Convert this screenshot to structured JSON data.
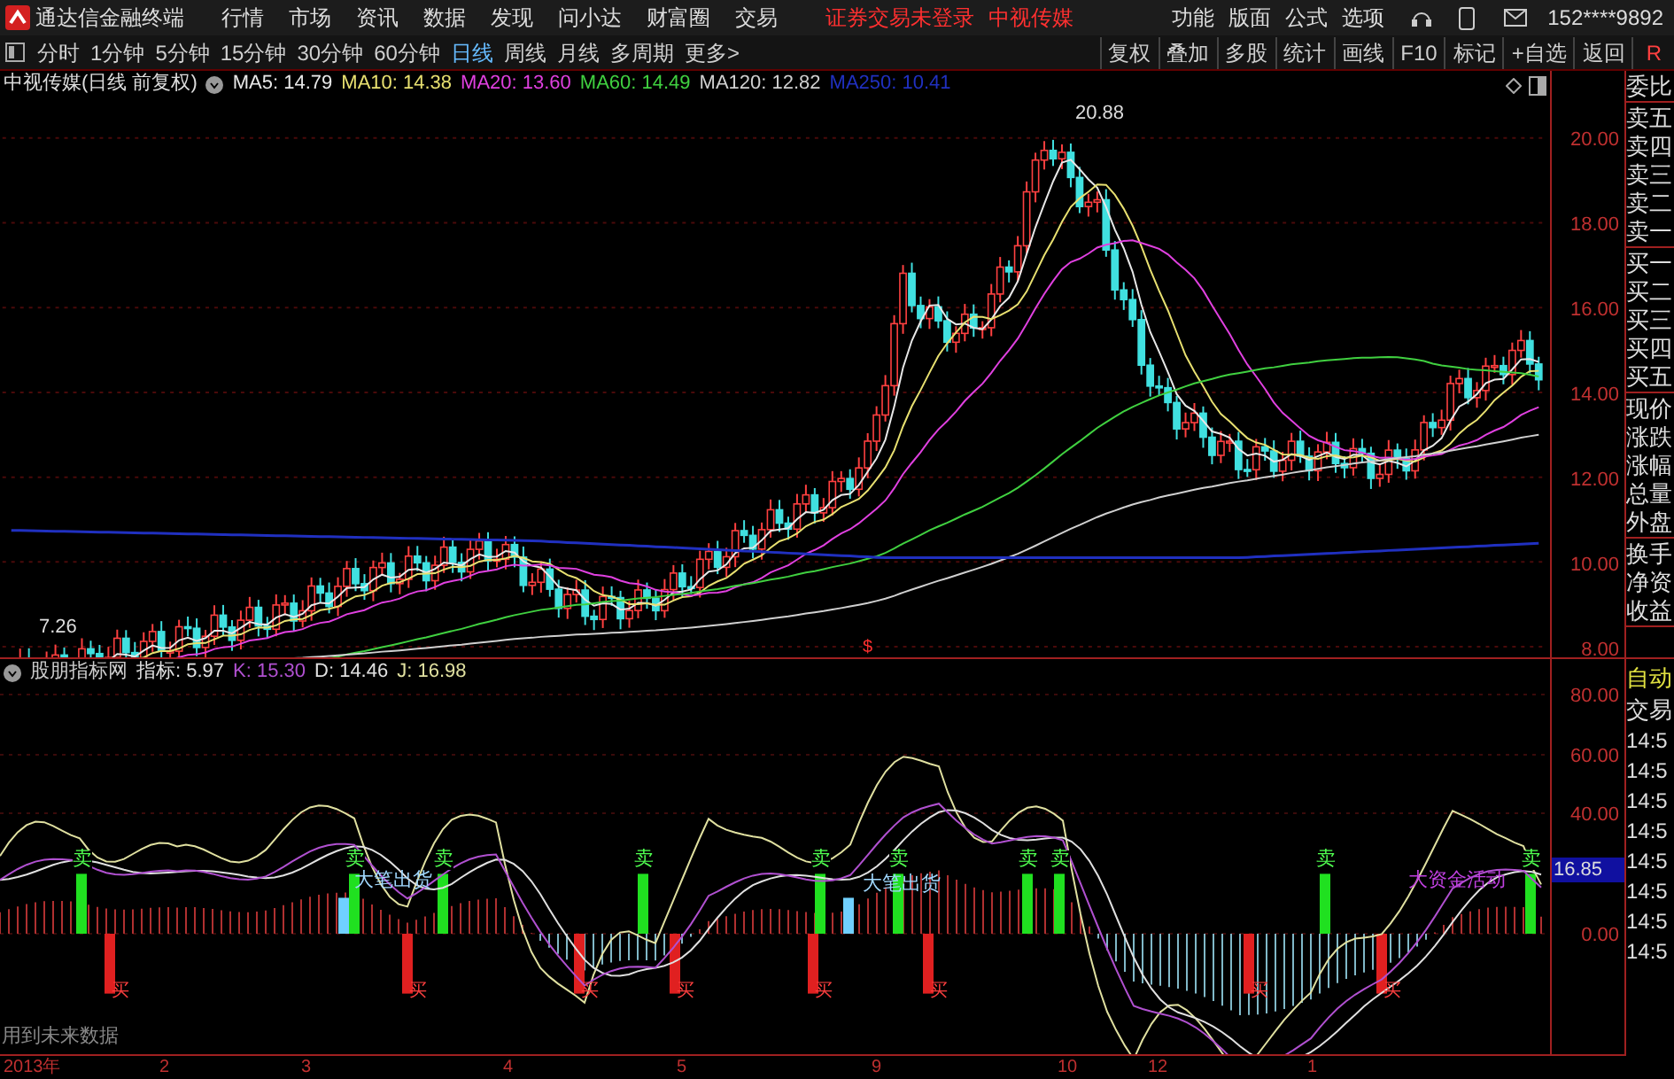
{
  "app": {
    "title": "通达信金融终端",
    "menus": [
      "行情",
      "市场",
      "资讯",
      "数据",
      "发现",
      "问小达",
      "财富圈",
      "交易"
    ],
    "status": "证券交易未登录",
    "stock": "中视传媒",
    "right_menus": [
      "功能",
      "版面",
      "公式",
      "选项"
    ],
    "user": "152****9892"
  },
  "periods": [
    {
      "label": "分时",
      "selected": false
    },
    {
      "label": "1分钟",
      "selected": false
    },
    {
      "label": "5分钟",
      "selected": false
    },
    {
      "label": "15分钟",
      "selected": false
    },
    {
      "label": "30分钟",
      "selected": false
    },
    {
      "label": "60分钟",
      "selected": false
    },
    {
      "label": "日线",
      "selected": true
    },
    {
      "label": "周线",
      "selected": false
    },
    {
      "label": "月线",
      "selected": false
    },
    {
      "label": "多周期",
      "selected": false
    },
    {
      "label": "更多>",
      "selected": false
    }
  ],
  "tools": [
    "复权",
    "叠加",
    "多股",
    "统计",
    "画线",
    "F10",
    "标记",
    "+自选",
    "返回",
    "R"
  ],
  "main_chart": {
    "title": "中视传媒(日线 前复权)",
    "ma": [
      {
        "label": "MA5: 14.79",
        "color": "#e8e8e8"
      },
      {
        "label": "MA10: 14.38",
        "color": "#e8e070"
      },
      {
        "label": "MA20: 13.60",
        "color": "#e040e0"
      },
      {
        "label": "MA60: 14.49",
        "color": "#40d040"
      },
      {
        "label": "MA120: 12.82",
        "color": "#d0d0d0"
      },
      {
        "label": "MA250: 10.41",
        "color": "#2030c0"
      }
    ],
    "high": "20.88",
    "low": "7.26",
    "marker": "$",
    "yticks": [
      "20.00",
      "18.00",
      "16.00",
      "14.00",
      "12.00",
      "10.00",
      "8.00"
    ]
  },
  "indicator": {
    "name": "股朋指标网",
    "values": [
      {
        "label": "指标: 5.97",
        "color": "#e0e0e0"
      },
      {
        "label": "K: 15.30",
        "color": "#b050d0"
      },
      {
        "label": "D: 14.46",
        "color": "#e0e0e0"
      },
      {
        "label": "J: 16.98",
        "color": "#e0e0a0"
      }
    ],
    "yticks": [
      "80.00",
      "60.00",
      "40.00",
      "0.00"
    ],
    "current": "16.85",
    "sell_marks": [
      "卖",
      "卖",
      "卖",
      "卖",
      "卖",
      "卖",
      "卖",
      "卖",
      "卖",
      "卖"
    ],
    "buy_marks": [
      "买",
      "买",
      "买",
      "买",
      "买",
      "买",
      "买",
      "买"
    ],
    "notes": [
      {
        "text": "大笔出货",
        "color": "#a0d8ff"
      },
      {
        "text": "大笔出货",
        "color": "#a0d8ff"
      },
      {
        "text": "大资金活动",
        "color": "#c040e0"
      }
    ],
    "footnote": "用到未来数据"
  },
  "dates": [
    "2013年",
    "2",
    "3",
    "4",
    "5",
    "9",
    "10",
    "12",
    "1"
  ],
  "quote_panel": [
    {
      "items": [
        "委比"
      ]
    },
    {
      "items": [
        "卖五",
        "卖四",
        "卖三",
        "卖二",
        "卖一"
      ]
    },
    {
      "items": [
        "买一",
        "买二",
        "买三",
        "买四",
        "买五"
      ]
    },
    {
      "items": [
        "现价",
        "涨跌",
        "涨幅",
        "总量",
        "外盘"
      ]
    },
    {
      "items": [
        "换手",
        "净资",
        "收益"
      ]
    }
  ],
  "trade_panel": {
    "auto": "自动",
    "trade": "交易",
    "times": [
      "14:5",
      "14:5",
      "14:5",
      "14:5",
      "14:5",
      "14:5",
      "14:5",
      "14:5"
    ]
  }
}
